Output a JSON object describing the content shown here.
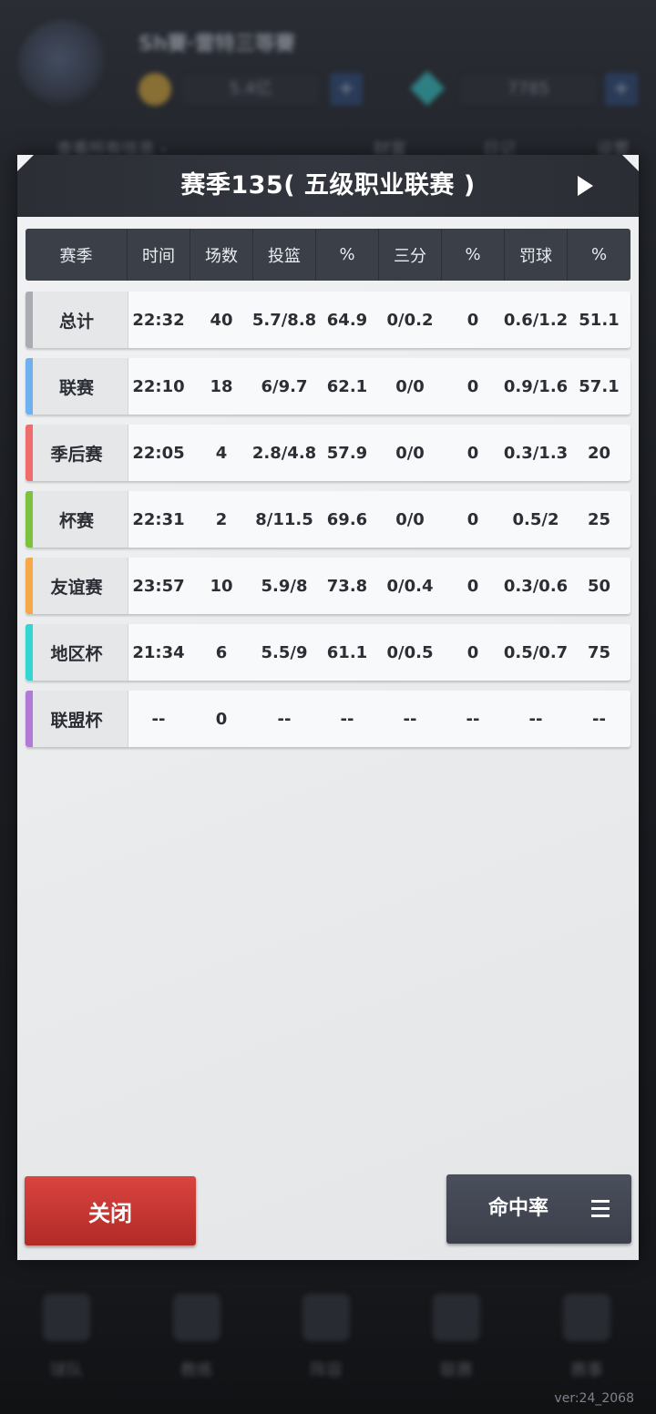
{
  "background": {
    "title": "Sh賽·雷特三等賽",
    "coins": "5.4亿",
    "gems": "7785",
    "menu": [
      "查看所有信息 ›",
      "财富",
      "日记",
      "设置"
    ],
    "tabs": [
      "球队",
      "教练",
      "阵容",
      "联赛",
      "赛事"
    ],
    "version": "ver:24_2068"
  },
  "modal": {
    "title": "赛季135( 五级职业联赛 )",
    "columns": [
      "赛季",
      "时间",
      "场数",
      "投篮",
      "%",
      "三分",
      "%",
      "罚球",
      "%"
    ],
    "rows": [
      {
        "label": "总计",
        "accent": "#a9acb1",
        "cells": [
          "22:32",
          "40",
          "5.7/8.8",
          "64.9",
          "0/0.2",
          "0",
          "0.6/1.2",
          "51.1"
        ]
      },
      {
        "label": "联赛",
        "accent": "#6fb0ee",
        "cells": [
          "22:10",
          "18",
          "6/9.7",
          "62.1",
          "0/0",
          "0",
          "0.9/1.6",
          "57.1"
        ]
      },
      {
        "label": "季后赛",
        "accent": "#ef6c6c",
        "cells": [
          "22:05",
          "4",
          "2.8/4.8",
          "57.9",
          "0/0",
          "0",
          "0.3/1.3",
          "20"
        ]
      },
      {
        "label": "杯赛",
        "accent": "#7dc23d",
        "cells": [
          "22:31",
          "2",
          "8/11.5",
          "69.6",
          "0/0",
          "0",
          "0.5/2",
          "25"
        ]
      },
      {
        "label": "友谊赛",
        "accent": "#f7a94a",
        "cells": [
          "23:57",
          "10",
          "5.9/8",
          "73.8",
          "0/0.4",
          "0",
          "0.3/0.6",
          "50"
        ]
      },
      {
        "label": "地区杯",
        "accent": "#33d6d1",
        "cells": [
          "21:34",
          "6",
          "5.5/9",
          "61.1",
          "0/0.5",
          "0",
          "0.5/0.7",
          "75"
        ]
      },
      {
        "label": "联盟杯",
        "accent": "#b07ad6",
        "cells": [
          "--",
          "0",
          "--",
          "--",
          "--",
          "--",
          "--",
          "--"
        ]
      }
    ],
    "close_label": "关闭",
    "sort_label": "命中率"
  }
}
